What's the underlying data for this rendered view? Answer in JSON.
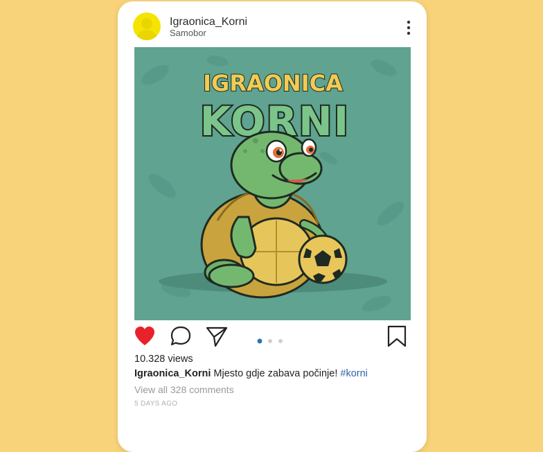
{
  "post": {
    "username": "Igraonica_Korni",
    "location": "Samobor",
    "image": {
      "logo_top": "IGRAONICA",
      "logo_bottom": "KORNI",
      "background_color": "#5fa390"
    },
    "carousel": {
      "count": 3,
      "active": 1
    },
    "icons": {
      "like": "heart-filled-icon",
      "comment": "comment-bubble-icon",
      "share": "paper-plane-icon",
      "save": "bookmark-icon",
      "more": "vertical-ellipsis-icon"
    },
    "views": "10.328 views",
    "caption_user": "Igraonica_Korni",
    "caption_text": "Mjesto gdje zabava počinje!",
    "caption_tag": "#korni",
    "comments_link": "View all 328 comments",
    "time_ago": "5 DAYS AGO"
  },
  "colors": {
    "background": "#f9d37a",
    "like_red": "#e8222b",
    "hashtag_blue": "#2f64a8",
    "dot_active": "#2f73b8"
  }
}
